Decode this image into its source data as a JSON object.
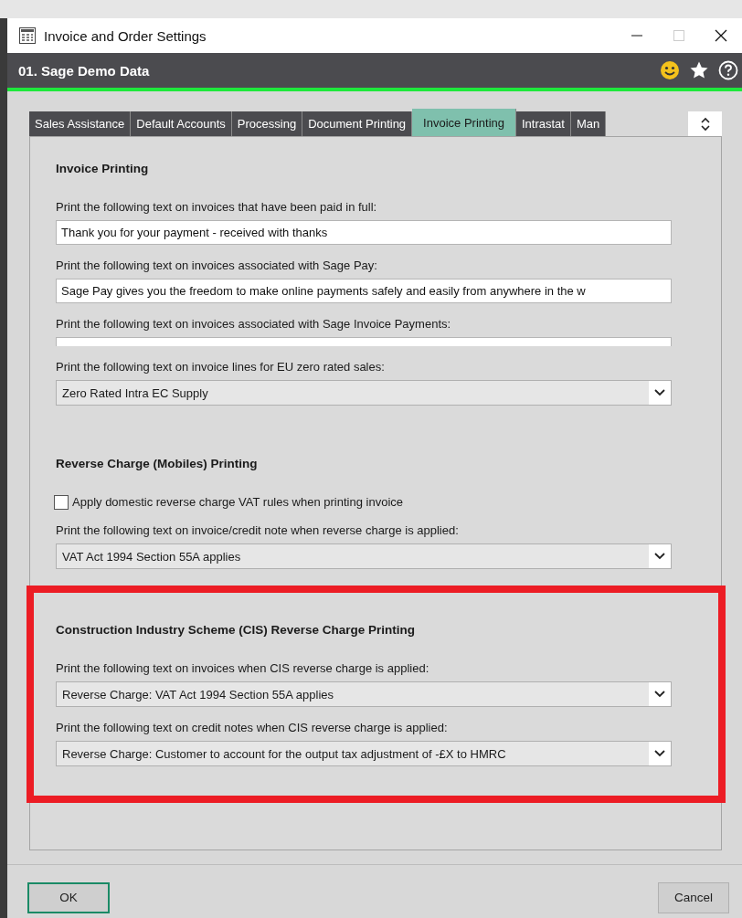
{
  "window": {
    "title": "Invoice and Order Settings"
  },
  "header": {
    "company": "01. Sage Demo Data"
  },
  "tabs": [
    {
      "label": "Sales Assistance",
      "selected": false
    },
    {
      "label": "Default Accounts",
      "selected": false
    },
    {
      "label": "Processing",
      "selected": false
    },
    {
      "label": "Document Printing",
      "selected": false
    },
    {
      "label": "Invoice Printing",
      "selected": true
    },
    {
      "label": "Intrastat",
      "selected": false
    },
    {
      "label": "Man",
      "selected": false
    }
  ],
  "sections": [
    {
      "title": "Invoice Printing",
      "highlighted": false,
      "items": [
        {
          "kind": "text",
          "label": "Print the following text on invoices that have been paid in full:",
          "value": "Thank you for your payment - received with thanks"
        },
        {
          "kind": "text",
          "label": "Print the following text on invoices associated with Sage Pay:",
          "value": "Sage Pay gives you the freedom to make online payments safely and easily from anywhere in the w"
        },
        {
          "kind": "clipped",
          "label": "Print the following text on invoices associated with Sage Invoice Payments:"
        },
        {
          "kind": "dropdown",
          "label": "Print the following text on invoice lines for EU zero rated sales:",
          "value": "Zero Rated Intra EC Supply"
        }
      ]
    },
    {
      "title": "Reverse Charge (Mobiles) Printing",
      "highlighted": false,
      "items": [
        {
          "kind": "checkbox",
          "label": "Apply domestic reverse charge VAT rules when printing invoice",
          "checked": false
        },
        {
          "kind": "dropdown",
          "label": "Print the following text on invoice/credit note when reverse charge is applied:",
          "value": "VAT Act 1994 Section 55A applies"
        }
      ]
    },
    {
      "title": "Construction Industry Scheme (CIS) Reverse Charge Printing",
      "highlighted": true,
      "items": [
        {
          "kind": "dropdown",
          "label": "Print the following text on invoices when CIS reverse charge is applied:",
          "value": "Reverse Charge: VAT Act 1994 Section 55A applies"
        },
        {
          "kind": "dropdown",
          "label": "Print the following text on credit notes when CIS reverse charge is applied:",
          "value": "Reverse Charge: Customer to account for the output tax adjustment of -£X to HMRC"
        }
      ]
    }
  ],
  "buttons": [
    {
      "label": "OK",
      "default": true
    },
    {
      "label": "Cancel",
      "default": false
    }
  ]
}
